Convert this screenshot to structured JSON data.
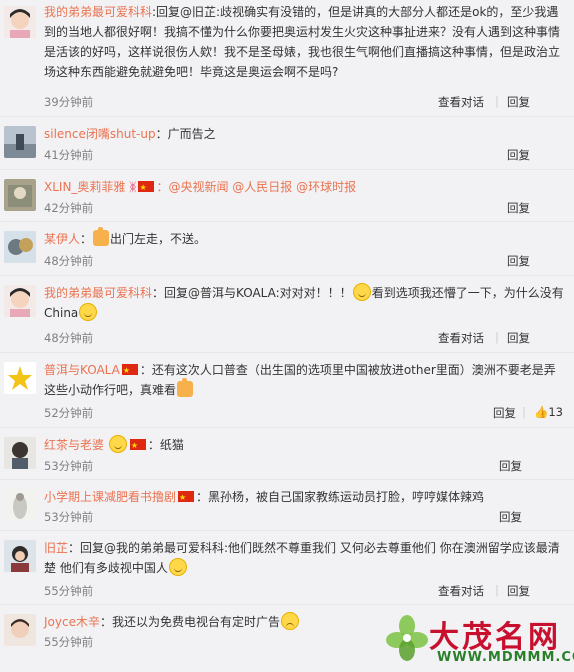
{
  "comments": [
    {
      "user": "我的弟弟最可爱科科",
      "text": ":回复@旧芷:歧视确实有没错的，但是讲真的大部分人都还是ok的，至少我遇到的当地人都很好啊！我搞不懂为什么你要把奥运村发生火灾这种事扯进来？没有人遇到这种事情是活该的好吗，这样说很伤人欸！我不是圣母婊，我也很生气啊他们直播搞这种事情，但是政治立场这种东西能避免就避免吧！毕竟这是奥运会啊不是吗?",
      "time": "39分钟前",
      "actions": [
        "查看对话",
        "回复"
      ]
    },
    {
      "user": "silence闭嘴shut-up",
      "text": "：广而告之",
      "time": "41分钟前",
      "actions": [
        "回复"
      ]
    },
    {
      "user": "XLIN_奥莉菲雅",
      "text": "：@央视新闻 @人民日报 @环球时报",
      "time": "42分钟前",
      "actions": [
        "回复"
      ]
    },
    {
      "user": "某伊人",
      "text": "出门左走，不送。",
      "time": "48分钟前",
      "actions": [
        "回复"
      ]
    },
    {
      "user": "我的弟弟最可爱科科",
      "text_a": "：回复@普洱与KOALA:对对对！！！",
      "text_b": "看到选项我还懵了一下，为什么没有China",
      "time": "48分钟前",
      "actions": [
        "查看对话",
        "回复"
      ]
    },
    {
      "user": "普洱与KOALA",
      "text": "：还有这次人口普查（出生国的选项里中国被放进other里面）澳洲不要老是弄这些小动作行吧，真难看",
      "time": "52分钟前",
      "actions": [
        "回复"
      ],
      "likes": "13"
    },
    {
      "user": "红茶与老婆",
      "text": "：纸猫",
      "time": "53分钟前",
      "actions": [
        "回复"
      ]
    },
    {
      "user": "小学期上课减肥看书撸剧",
      "text": "：黑孙杨，被自己国家教练运动员打脸，哼哼媒体辣鸡",
      "time": "53分钟前",
      "actions": [
        "回复"
      ]
    },
    {
      "user": "旧芷",
      "text": "：回复@我的弟弟最可爱科科:他们既然不尊重我们 又何必去尊重他们 你在澳洲留学应该最清楚 他们有多歧视中国人",
      "time": "55分钟前",
      "actions": [
        "查看对话",
        "回复"
      ]
    },
    {
      "user": "Joyce木辛",
      "text": "：我还以为免费电视台有定时广告",
      "time": "55分钟前",
      "actions": []
    }
  ],
  "watermark": {
    "title": "大茂名网",
    "url": "WWW.MDMMM.COM"
  }
}
